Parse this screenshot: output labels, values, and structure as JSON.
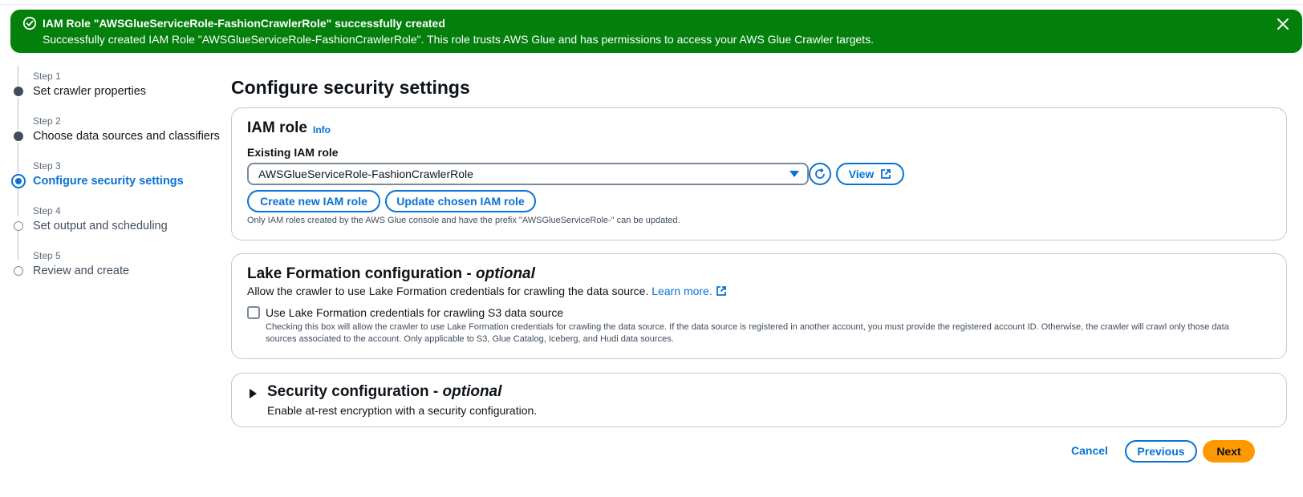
{
  "flash": {
    "title": "IAM Role \"AWSGlueServiceRole-FashionCrawlerRole\" successfully created",
    "message": "Successfully created IAM Role \"AWSGlueServiceRole-FashionCrawlerRole\". This role trusts AWS Glue and has permissions to access your AWS Glue Crawler targets.",
    "status_icon": "success-check-circle-icon",
    "close_icon": "close-icon",
    "color": "#037f0c"
  },
  "steps": [
    {
      "number": "Step 1",
      "label": "Set crawler properties",
      "state": "completed"
    },
    {
      "number": "Step 2",
      "label": "Choose data sources and classifiers",
      "state": "completed"
    },
    {
      "number": "Step 3",
      "label": "Configure security settings",
      "state": "active"
    },
    {
      "number": "Step 4",
      "label": "Set output and scheduling",
      "state": "upcoming"
    },
    {
      "number": "Step 5",
      "label": "Review and create",
      "state": "upcoming"
    }
  ],
  "page_title": "Configure security settings",
  "iam": {
    "heading": "IAM role",
    "info": "Info",
    "field_label": "Existing IAM role",
    "selected_role": "AWSGlueServiceRole-FashionCrawlerRole",
    "view_label": "View",
    "create_label": "Create new IAM role",
    "update_label": "Update chosen IAM role",
    "hint": "Only IAM roles created by the AWS Glue console and have the prefix \"AWSGlueServiceRole-\" can be updated."
  },
  "lake": {
    "heading": "Lake Formation configuration - ",
    "heading_optional": "optional",
    "description": "Allow the crawler to use Lake Formation credentials for crawling the data source.",
    "learn_more": "Learn more.",
    "checkbox_label": "Use Lake Formation credentials for crawling S3 data source",
    "checkbox_checked": false,
    "checkbox_description": "Checking this box will allow the crawler to use Lake Formation credentials for crawling the data source. If the data source is registered in another account, you must provide the registered account ID. Otherwise, the crawler will crawl only those data sources associated to the account. Only applicable to S3, Glue Catalog, Iceberg, and Hudi data sources."
  },
  "security": {
    "heading": "Security configuration - ",
    "heading_optional": "optional",
    "description": "Enable at-rest encryption with a security configuration.",
    "expanded": false
  },
  "footer": {
    "cancel": "Cancel",
    "previous": "Previous",
    "next": "Next"
  },
  "colors": {
    "accent": "#0972d3",
    "primary_button": "#ff9900",
    "success": "#037f0c"
  }
}
